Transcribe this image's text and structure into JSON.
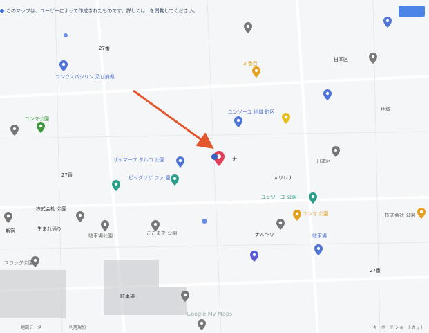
{
  "notice": {
    "text": "このマップは、ユーザーによって作成されたものです。詳しくは",
    "link": "",
    "tail": "を閲覧してください。"
  },
  "top_link": "",
  "top_button": "",
  "center_label": "ナ",
  "labels": {
    "l1": "27番",
    "l2": "ランクスパジリン 及び府県",
    "l3": "3 番目",
    "l4": "ユンソーユ 地域 町区",
    "l5": "日本区",
    "l6": "地域",
    "l7": "ユンマ公園",
    "l8": "ザイマーフ タルコ 公園",
    "l9": "27番",
    "l10": "ビッグリザ ファ 園",
    "l11": "株式会社 公園",
    "l12": "日本区",
    "l13": "新宿",
    "l14": "生まれ通り",
    "l15": "駐車場公園",
    "l16": "ここまで 公園",
    "l17": "フラッグ公園",
    "l18": "駐車場",
    "l19": "人リレナ",
    "l20": "ユンソーユ 公園",
    "l21": "ユンマ 公園",
    "l22": "ナルキリ",
    "l23": "駐車場",
    "l24": "株式会社 公園",
    "l25": "27番"
  },
  "brand": "Google My Maps",
  "footer": {
    "left": "地図データ",
    "mid": "利用規約",
    "right": "キーボード ショートカット"
  }
}
